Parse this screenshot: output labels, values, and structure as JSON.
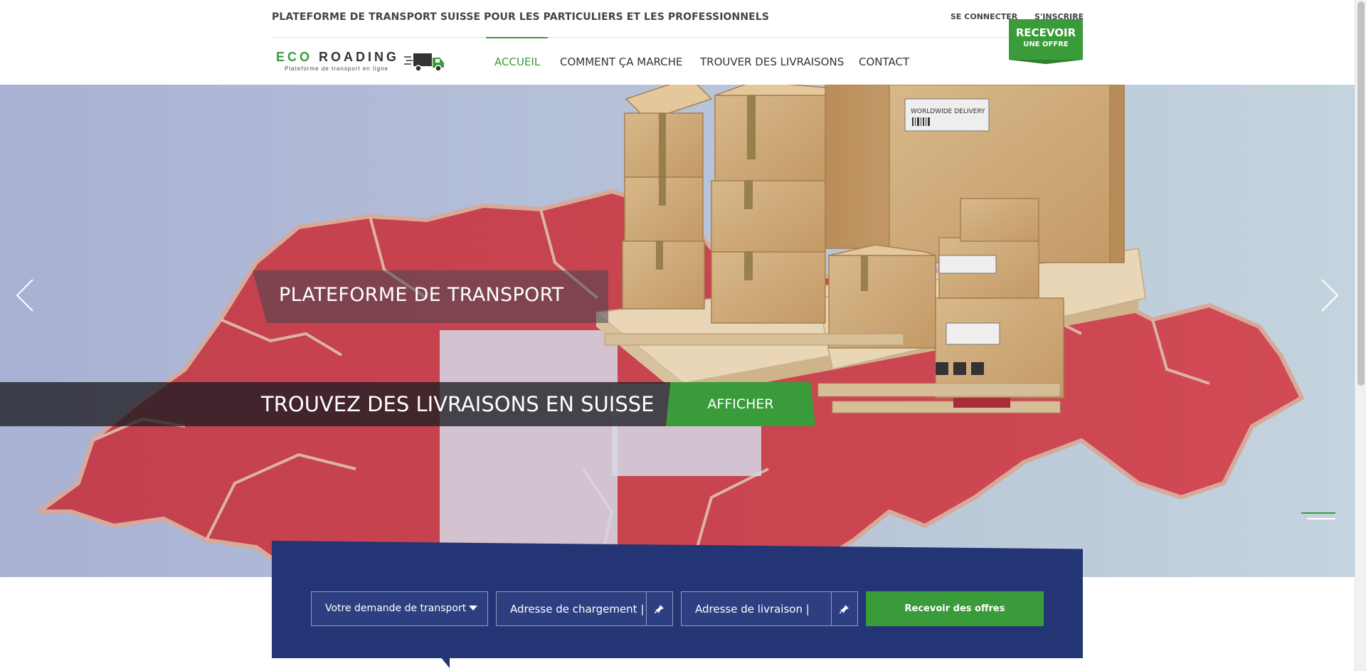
{
  "topbar": {
    "tagline": "PLATEFORME DE TRANSPORT SUISSE POUR LES PARTICULIERS ET LES PROFESSIONNELS",
    "login_label": "SE CONNECTER",
    "signup_label": "S'INSCRIRE"
  },
  "logo": {
    "brand_part1": "ECO",
    "brand_part2": "ROADING",
    "subtitle": "Plateforme de transport en ligne"
  },
  "nav": {
    "items": [
      {
        "label": "ACCUEIL",
        "active": true
      },
      {
        "label": "COMMENT ÇA MARCHE",
        "active": false
      },
      {
        "label": "TROUVER DES LIVRAISONS",
        "active": false
      },
      {
        "label": "CONTACT",
        "active": false
      }
    ],
    "cta_line1": "RECEVOIR",
    "cta_line2": "UNE OFFRE"
  },
  "hero": {
    "caption_top": "PLATEFORME DE TRANSPORT",
    "caption_main": "TROUVEZ DES LIVRAISONS EN SUISSE",
    "button_label": "AFFICHER",
    "box_label": "WORLDWIDE DELIVERY",
    "icons": {
      "prev": "chevron-left-icon",
      "next": "chevron-right-icon"
    }
  },
  "search": {
    "request_type_value": "Votre demande de transport",
    "loading_placeholder": "Adresse de chargement |",
    "delivery_placeholder": "Adresse de livraison |",
    "submit_label": "Recevoir des offres",
    "pin_icon": "pin-icon"
  },
  "colors": {
    "accent_green": "#3a9b3a",
    "panel_blue": "#233574",
    "swiss_red": "#c8424f"
  }
}
